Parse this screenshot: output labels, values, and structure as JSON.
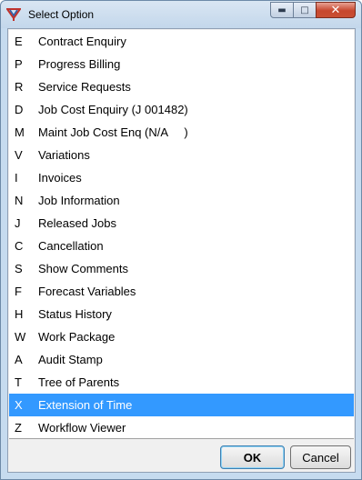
{
  "window": {
    "title": "Select Option",
    "icon": "tree-logo-icon"
  },
  "options": [
    {
      "key": "E",
      "label": "Contract Enquiry"
    },
    {
      "key": "P",
      "label": "Progress Billing"
    },
    {
      "key": "R",
      "label": "Service Requests"
    },
    {
      "key": "D",
      "label": "Job Cost Enquiry (J 001482)"
    },
    {
      "key": "M",
      "label": "Maint Job Cost Enq (N/A     )"
    },
    {
      "key": "V",
      "label": "Variations"
    },
    {
      "key": "I",
      "label": "Invoices"
    },
    {
      "key": "N",
      "label": "Job Information"
    },
    {
      "key": "J",
      "label": "Released Jobs"
    },
    {
      "key": "C",
      "label": "Cancellation"
    },
    {
      "key": "S",
      "label": "Show Comments"
    },
    {
      "key": "F",
      "label": "Forecast Variables"
    },
    {
      "key": "H",
      "label": "Status History"
    },
    {
      "key": "W",
      "label": "Work Package"
    },
    {
      "key": "A",
      "label": "Audit Stamp"
    },
    {
      "key": "T",
      "label": "Tree of Parents"
    },
    {
      "key": "X",
      "label": "Extension of Time",
      "selected": true
    },
    {
      "key": "Z",
      "label": "Workflow Viewer"
    }
  ],
  "buttons": {
    "ok": "OK",
    "cancel": "Cancel"
  },
  "colors": {
    "selection": "#3399ff",
    "titlebar": "#c6dbef",
    "close": "#c7472e"
  }
}
